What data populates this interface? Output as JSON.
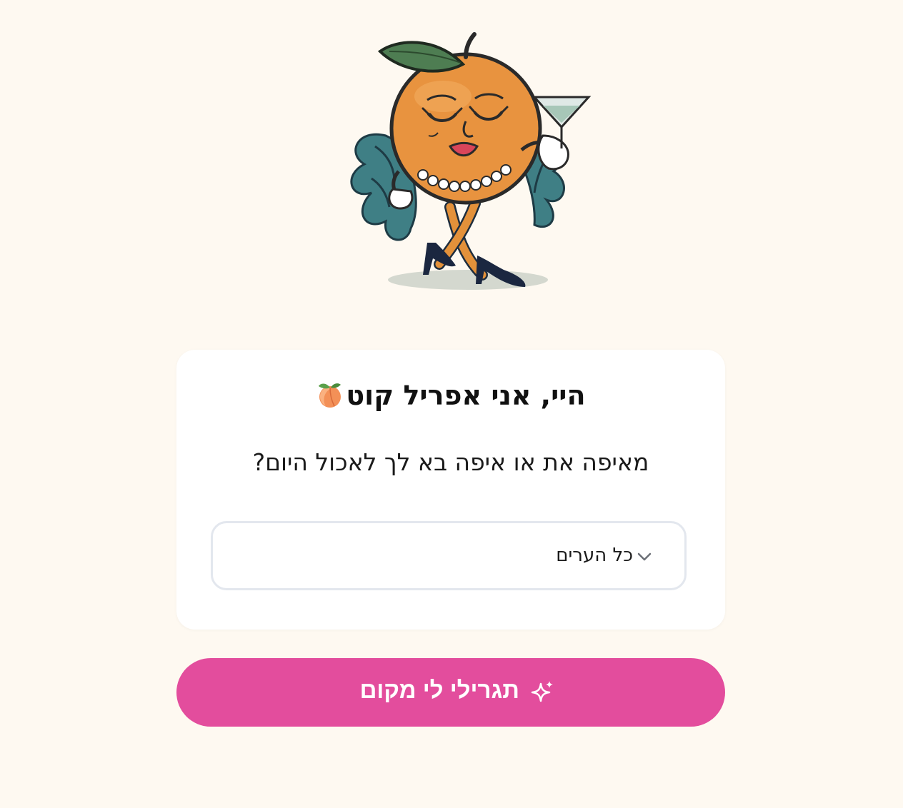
{
  "header": {
    "mascot": "peach-character-illustration"
  },
  "card": {
    "title": "היי, אני אפריל קוט",
    "title_emoji": "peach-icon",
    "subtitle": "מאיפה את או איפה בא לך לאכול היום?",
    "city_select": {
      "value": "כל הערים",
      "icon": "chevron-down-icon"
    }
  },
  "cta": {
    "label": "תגרילי לי מקום",
    "icon": "sparkle-icon"
  },
  "colors": {
    "background": "#fef9f1",
    "card": "#ffffff",
    "accent": "#e34d9d",
    "select_border": "#e3e7ee"
  }
}
